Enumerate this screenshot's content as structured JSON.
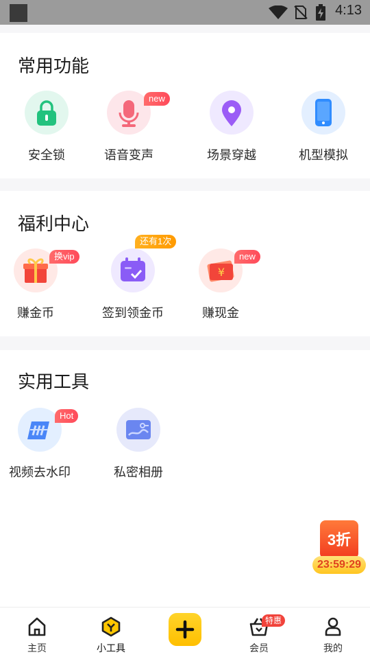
{
  "status_bar": {
    "time": "4:13"
  },
  "sections": {
    "common": {
      "title": "常用功能",
      "items": [
        {
          "label": "安全锁",
          "icon": "lock-icon"
        },
        {
          "label": "语音变声",
          "icon": "microphone-icon",
          "badge": "new"
        },
        {
          "label": "场景穿越",
          "icon": "location-pin-icon"
        },
        {
          "label": "机型模拟",
          "icon": "phone-icon"
        }
      ]
    },
    "welfare": {
      "title": "福利中心",
      "items": [
        {
          "label": "赚金币",
          "icon": "gift-icon",
          "badge": "换vip"
        },
        {
          "label": "签到领金币",
          "icon": "calendar-check-icon",
          "badge": "还有1次"
        },
        {
          "label": "赚现金",
          "icon": "cash-icon",
          "badge": "new"
        }
      ]
    },
    "tools": {
      "title": "实用工具",
      "items": [
        {
          "label": "视频去水印",
          "icon": "watermark-remove-icon",
          "badge": "Hot"
        },
        {
          "label": "私密相册",
          "icon": "private-album-icon"
        }
      ]
    }
  },
  "promo": {
    "discount": "3折",
    "countdown": "23:59:29"
  },
  "tabbar": [
    {
      "label": "主页",
      "icon": "home-icon"
    },
    {
      "label": "小工具",
      "icon": "tools-icon"
    },
    {
      "label": "",
      "icon": "plus-icon"
    },
    {
      "label": "会员",
      "icon": "vip-basket-icon",
      "badge": "特惠"
    },
    {
      "label": "我的",
      "icon": "profile-icon"
    }
  ],
  "colors": {
    "accent_yellow": "#ffc700",
    "badge_red": "#ff5a5f",
    "badge_orange": "#ffa600",
    "promo_red": "#f23a1f"
  }
}
